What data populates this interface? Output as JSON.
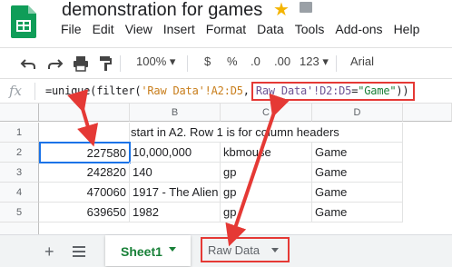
{
  "doc": {
    "title": "demonstration for games"
  },
  "menu": [
    "File",
    "Edit",
    "View",
    "Insert",
    "Format",
    "Data",
    "Tools",
    "Add-ons",
    "Help"
  ],
  "toolbar": {
    "zoom": "100%",
    "currency": "$",
    "percent": "%",
    "dec_less": ".0",
    "dec_more": ".00",
    "number_format": "123",
    "font": "Arial"
  },
  "formula_bar": {
    "fx": "fx",
    "p1": "=unique(filter(",
    "p2": "'Raw Data'!A2:D5",
    "p3": ",",
    "p4": "'Raw Data'!D2:D5",
    "p5": "=",
    "p6": "\"Game\"",
    "p7": "))"
  },
  "grid": {
    "columns": [
      "B",
      "C",
      "D"
    ],
    "rows": [
      "1",
      "2",
      "3",
      "4",
      "5"
    ],
    "note": "start in A2. Row 1 is for column headers",
    "data": [
      [
        "227580",
        "10,000,000",
        "kbmouse",
        "Game"
      ],
      [
        "242820",
        "140",
        "gp",
        "Game"
      ],
      [
        "470060",
        "1917 - The Alien",
        "gp",
        "Game"
      ],
      [
        "639650",
        "1982",
        "gp",
        "Game"
      ]
    ]
  },
  "sheets": {
    "tabs": [
      "Sheet1",
      "Raw Data"
    ]
  },
  "colors": {
    "accent_green": "#188038",
    "annotation_red": "#e53935",
    "selection_blue": "#1a73e8"
  }
}
